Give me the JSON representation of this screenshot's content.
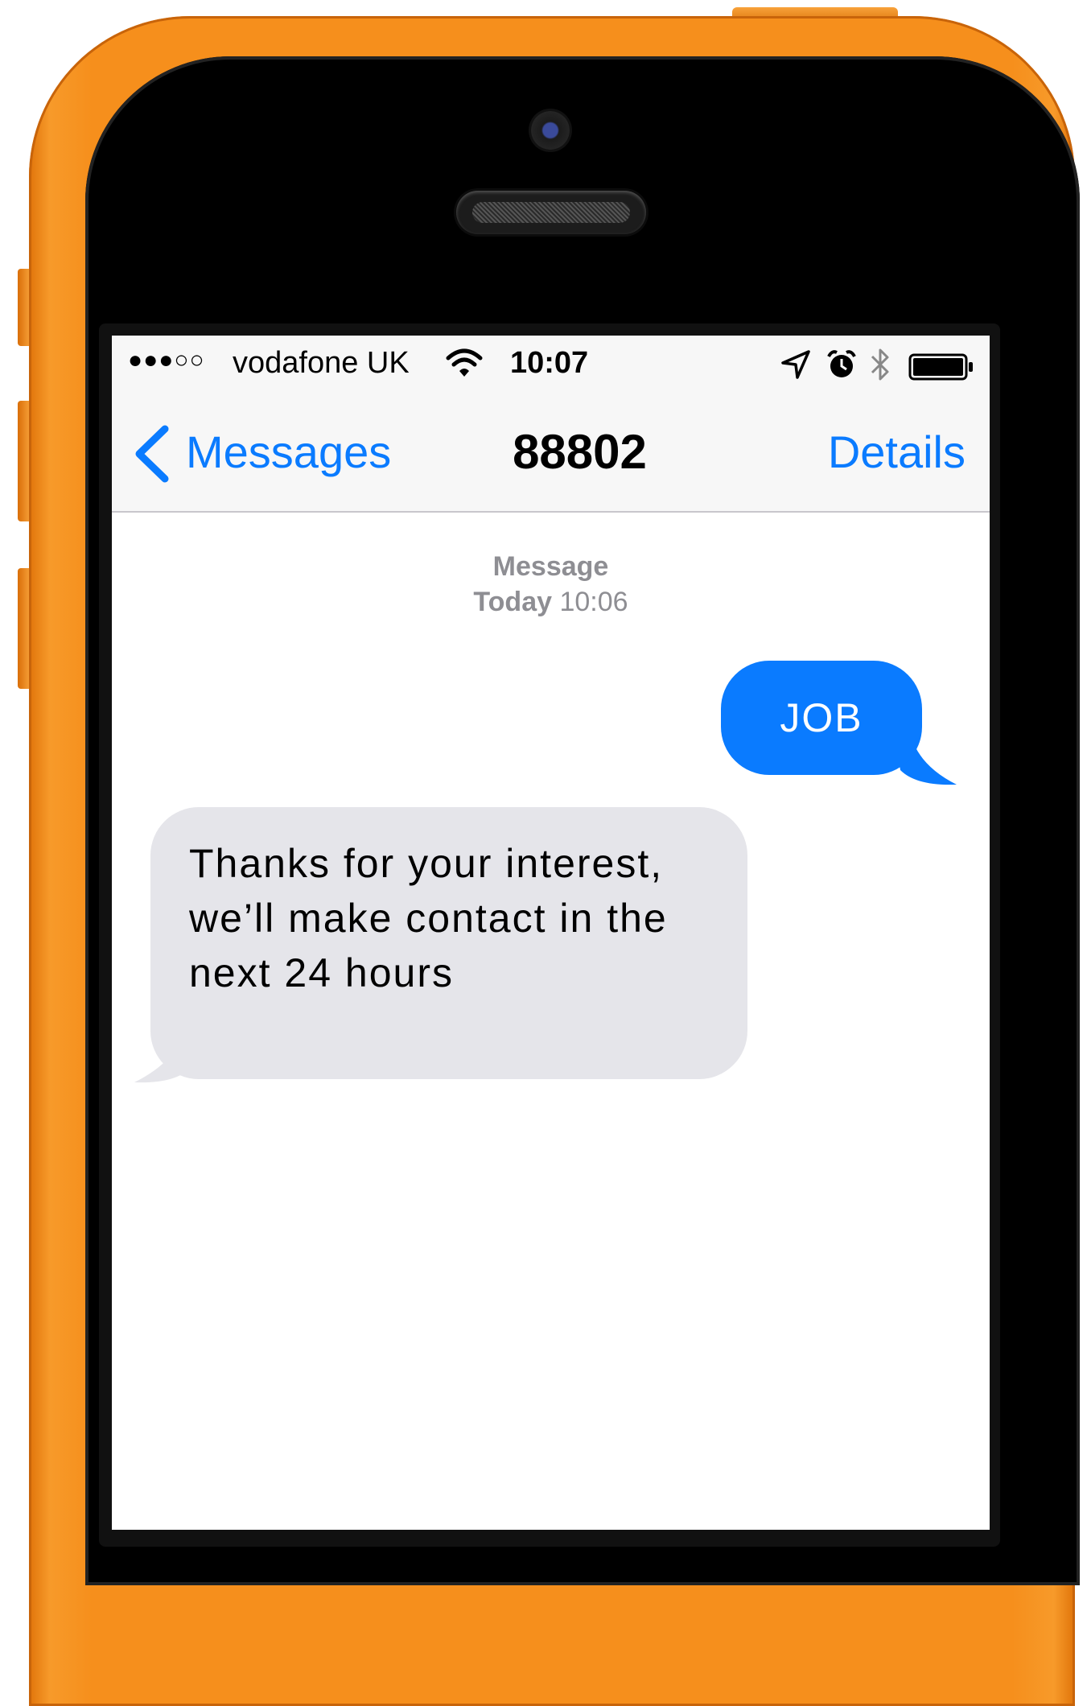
{
  "status_bar": {
    "signal": "●●●○○",
    "carrier": "vodafone UK",
    "time": "10:07"
  },
  "nav": {
    "back_label": "Messages",
    "title": "88802",
    "details_label": "Details"
  },
  "thread": {
    "timestamp_label": "Message",
    "timestamp_day": "Today",
    "timestamp_time": "10:06",
    "messages": [
      {
        "direction": "outgoing",
        "text": "JOB"
      },
      {
        "direction": "incoming",
        "text": "Thanks for your interest, we’ll make contact in the next 24 hours"
      }
    ]
  },
  "colors": {
    "accent": "#0a7bff",
    "outgoing_bubble": "#0a7bff",
    "incoming_bubble": "#e5e5ea",
    "phone_body": "#f68f1c"
  },
  "icons": [
    "wifi-icon",
    "location-arrow-icon",
    "alarm-icon",
    "bluetooth-icon",
    "battery-icon",
    "chevron-left-icon"
  ]
}
